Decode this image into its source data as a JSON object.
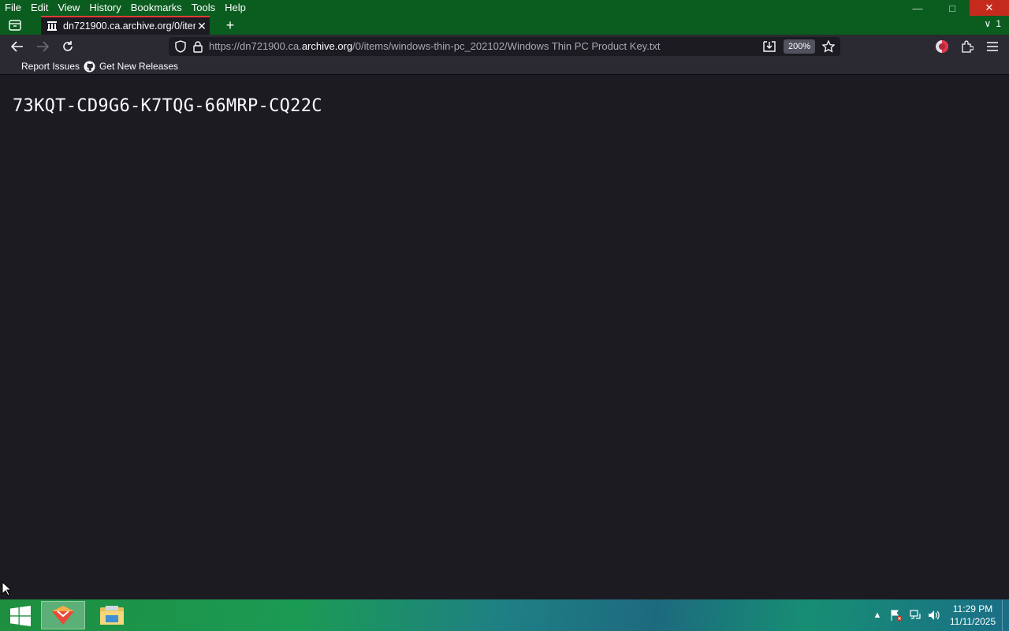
{
  "menu": [
    "File",
    "Edit",
    "View",
    "History",
    "Bookmarks",
    "Tools",
    "Help"
  ],
  "tab": {
    "title": "dn721900.ca.archive.org/0/item"
  },
  "tablist": {
    "count": "1"
  },
  "url": {
    "prefix": "https://dn721900.ca.",
    "host": "archive.org",
    "path": "/0/items/windows-thin-pc_202102/Windows Thin PC Product Key.txt",
    "zoom": "200%"
  },
  "bookmarks": [
    "Report Issues",
    "Get New Releases"
  ],
  "content": {
    "text": "73KQT-CD9G6-K7TQG-66MRP-CQ22C"
  },
  "taskbar": {
    "time": "11:29 PM",
    "date": "11/11/2025"
  },
  "colors": {
    "titlebar": "#0b5c1f",
    "close": "#c42b1c",
    "tab_accent": "#e53935",
    "page_bg": "#1c1b22",
    "toolbar": "#2b2a33"
  }
}
